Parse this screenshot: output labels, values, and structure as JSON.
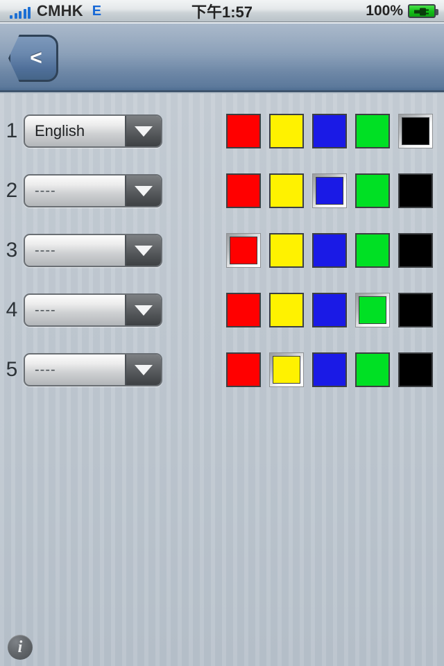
{
  "status_bar": {
    "signal_icon": "signal-bars-icon",
    "signal_bars_filled": 5,
    "carrier": "CMHK",
    "network_type": "E",
    "time": "下午1:57",
    "battery_percent": "100%",
    "battery_icon": "battery-charging-icon",
    "signal_color": "#1c6fd4",
    "network_color": "#1668d6",
    "battery_color": "#14c018"
  },
  "nav_bar": {
    "back_button_label": "<",
    "back_button_icon": "chevron-left-icon",
    "title": ""
  },
  "main": {
    "palette": [
      {
        "name": "red",
        "hex": "#FF0000"
      },
      {
        "name": "yellow",
        "hex": "#FFF200"
      },
      {
        "name": "blue",
        "hex": "#1A1AE6"
      },
      {
        "name": "green",
        "hex": "#00E024"
      },
      {
        "name": "black",
        "hex": "#000000"
      }
    ],
    "dropdown_placeholder": "----",
    "rows": [
      {
        "index": "1",
        "dropdown_value": "English",
        "selected_color_index": 4
      },
      {
        "index": "2",
        "dropdown_value": "----",
        "selected_color_index": 2
      },
      {
        "index": "3",
        "dropdown_value": "----",
        "selected_color_index": 0
      },
      {
        "index": "4",
        "dropdown_value": "----",
        "selected_color_index": 3
      },
      {
        "index": "5",
        "dropdown_value": "----",
        "selected_color_index": 1
      }
    ]
  },
  "footer": {
    "info_label": "i",
    "info_icon": "info-icon"
  }
}
